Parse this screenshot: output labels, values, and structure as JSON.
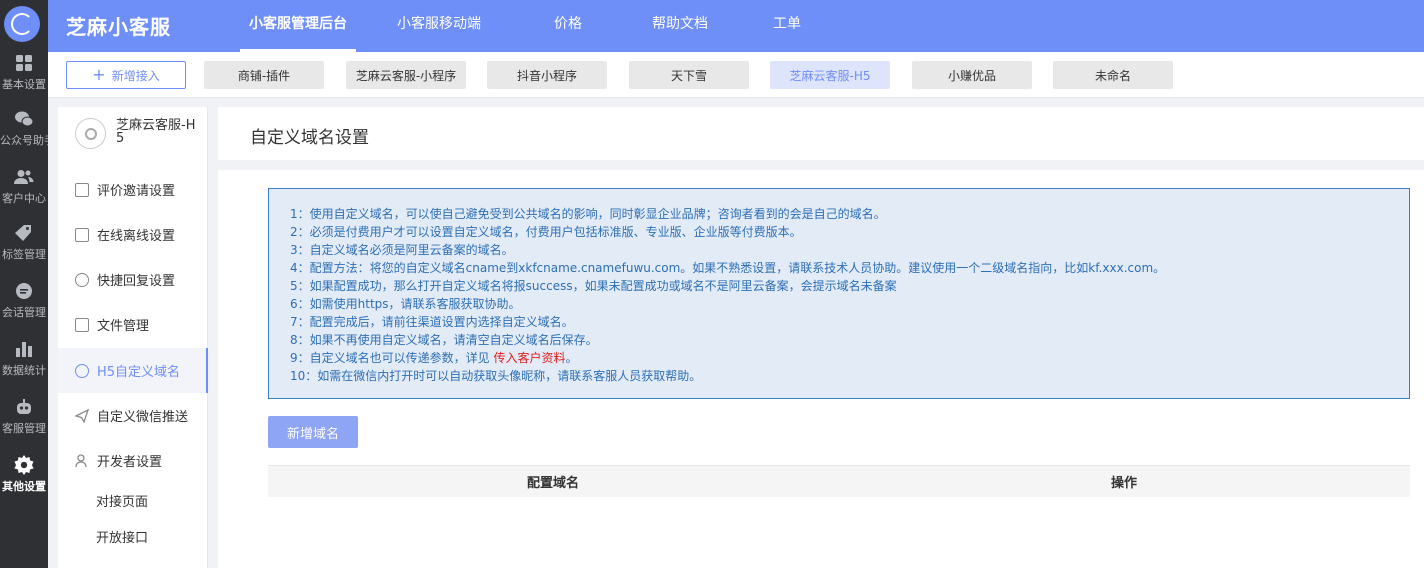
{
  "rail": {
    "items": [
      {
        "label": "基本设置",
        "icon": "grid-icon"
      },
      {
        "label": "公众号助手",
        "icon": "wechat-icon"
      },
      {
        "label": "客户中心",
        "icon": "users-icon"
      },
      {
        "label": "标签管理",
        "icon": "tag-icon"
      },
      {
        "label": "会话管理",
        "icon": "chat-icon"
      },
      {
        "label": "数据统计",
        "icon": "bar-chart-icon"
      },
      {
        "label": "客服管理",
        "icon": "robot-icon"
      },
      {
        "label": "其他设置",
        "icon": "gear-icon"
      }
    ]
  },
  "brand": "芝麻小客服",
  "topnav": {
    "items": [
      {
        "label": "小客服管理后台"
      },
      {
        "label": "小客服移动端"
      },
      {
        "label": "价格"
      },
      {
        "label": "帮助文档"
      },
      {
        "label": "工单"
      }
    ]
  },
  "tabstrip": {
    "new_label": "新增接入",
    "tabs": [
      {
        "label": "商铺-插件"
      },
      {
        "label": "芝麻云客服-小程序"
      },
      {
        "label": "抖音小程序"
      },
      {
        "label": "天下雪"
      },
      {
        "label": "芝麻云客服-H5"
      },
      {
        "label": "小赚优品"
      },
      {
        "label": "未命名"
      }
    ]
  },
  "sidebar": {
    "app_name": "芝麻云客服-H5",
    "items": [
      {
        "label": "评价邀请设置",
        "icon": "edit-icon"
      },
      {
        "label": "在线离线设置",
        "icon": "monitor-icon"
      },
      {
        "label": "快捷回复设置",
        "icon": "clock-icon"
      },
      {
        "label": "文件管理",
        "icon": "folder-icon"
      },
      {
        "label": "H5自定义域名",
        "icon": "globe-icon"
      },
      {
        "label": "自定义微信推送",
        "icon": "send-icon"
      },
      {
        "label": "开发者设置",
        "icon": "developer-icon"
      }
    ],
    "sub_items": [
      {
        "label": "对接页面"
      },
      {
        "label": "开放接口"
      }
    ]
  },
  "main": {
    "title": "自定义域名设置",
    "notice": {
      "lines": [
        "1：使用自定义域名，可以使自己避免受到公共域名的影响，同时彰显企业品牌；咨询者看到的会是自己的域名。",
        "2：必须是付费用户才可以设置自定义域名，付费用户包括标准版、专业版、企业版等付费版本。",
        "3：自定义域名必须是阿里云备案的域名。",
        "4：配置方法：将您的自定义域名cname到xkfcname.cnamefuwu.com。如果不熟悉设置，请联系技术人员协助。建议使用一个二级域名指向，比如kf.xxx.com。",
        "5：如果配置成功，那么打开自定义域名将报success，如果未配置成功或域名不是阿里云备案，会提示域名未备案",
        "6：如需使用https，请联系客服获取协助。",
        "7：配置完成后，请前往渠道设置内选择自定义域名。",
        "8：如果不再使用自定义域名，请清空自定义域名后保存。"
      ],
      "line9_prefix": "9：自定义域名也可以传递参数，详见 ",
      "line9_link": "传入客户资料",
      "line9_suffix": "。",
      "line10": "10：如需在微信内打开时可以自动获取头像昵称，请联系客服人员获取帮助。"
    },
    "add_button": "新增域名",
    "table": {
      "headers": [
        "配置域名",
        "操作"
      ]
    }
  },
  "colors": {
    "primary": "#6f8ff8",
    "rail_bg": "#2f3033",
    "notice_bg": "#e3ebf7",
    "notice_text": "#2d6fb5",
    "link_red": "#e02020"
  }
}
